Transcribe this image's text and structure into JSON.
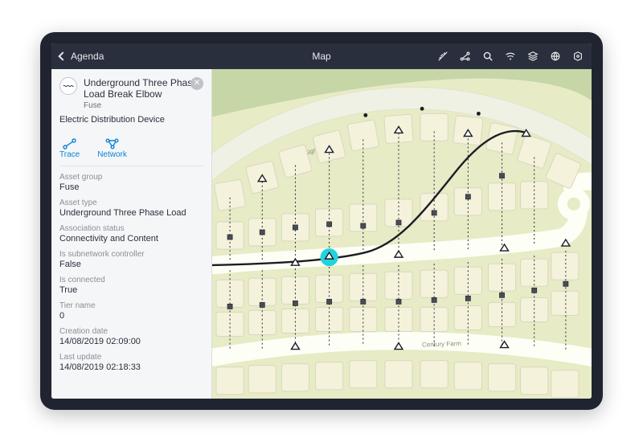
{
  "topbar": {
    "back_label": "Agenda",
    "title": "Map"
  },
  "panel": {
    "title": "Underground Three Phase Load Break Elbow",
    "subtitle": "Fuse",
    "category": "Electric Distribution Device",
    "actions": {
      "trace": "Trace",
      "network": "Network"
    },
    "fields": [
      {
        "label": "Asset group",
        "value": "Fuse"
      },
      {
        "label": "Asset type",
        "value": "Underground Three Phase Load"
      },
      {
        "label": "Association status",
        "value": "Connectivity and Content"
      },
      {
        "label": "Is subnetwork controller",
        "value": "False"
      },
      {
        "label": "Is connected",
        "value": "True"
      },
      {
        "label": "Tier name",
        "value": "0"
      },
      {
        "label": "Creation date",
        "value": "14/08/2019 02:09:00"
      },
      {
        "label": "Last update",
        "value": "14/08/2019 02:18:33"
      }
    ]
  },
  "map": {
    "roads": [
      "Sigmund Rd",
      "Century Farm"
    ]
  }
}
